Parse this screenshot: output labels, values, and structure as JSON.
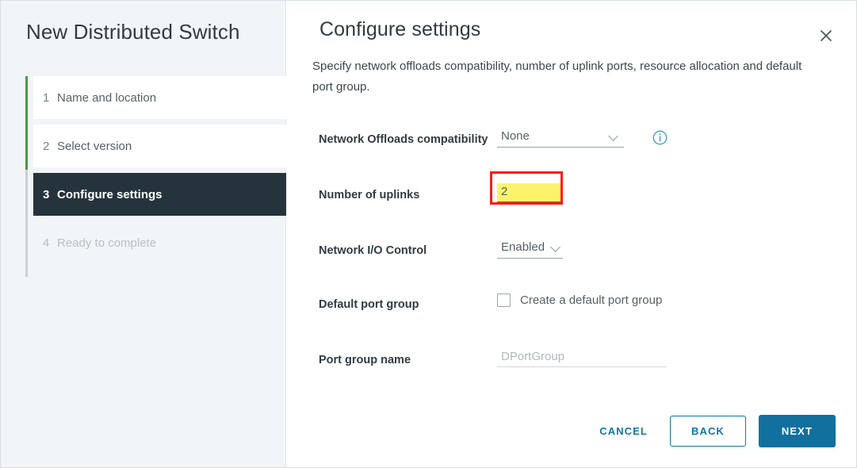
{
  "wizard": {
    "title": "New Distributed Switch",
    "steps": [
      {
        "number": "1",
        "label": "Name and location",
        "state": "done"
      },
      {
        "number": "2",
        "label": "Select version",
        "state": "done"
      },
      {
        "number": "3",
        "label": "Configure settings",
        "state": "active"
      },
      {
        "number": "4",
        "label": "Ready to complete",
        "state": "pending"
      }
    ]
  },
  "panel": {
    "title": "Configure settings",
    "description": "Specify network offloads compatibility, number of uplink ports, resource allocation and default port group.",
    "close_icon": "close-icon"
  },
  "form": {
    "network_offloads": {
      "label": "Network Offloads compatibility",
      "value": "None",
      "chevron_icon": "chevron-down-icon",
      "info_icon": "info-icon"
    },
    "uplinks": {
      "label": "Number of uplinks",
      "value": "2",
      "highlight_color": "#fa1e14",
      "field_background": "#fdf36b"
    },
    "nioc": {
      "label": "Network I/O Control",
      "value": "Enabled",
      "chevron_icon": "chevron-down-icon"
    },
    "default_port_group": {
      "label": "Default port group",
      "checkbox_label": "Create a default port group",
      "checked": false
    },
    "port_group_name": {
      "label": "Port group name",
      "value": "",
      "placeholder": "DPortGroup"
    }
  },
  "footer": {
    "cancel_label": "CANCEL",
    "back_label": "BACK",
    "next_label": "NEXT",
    "primary_color": "#11709e",
    "link_color": "#0f76a8"
  }
}
